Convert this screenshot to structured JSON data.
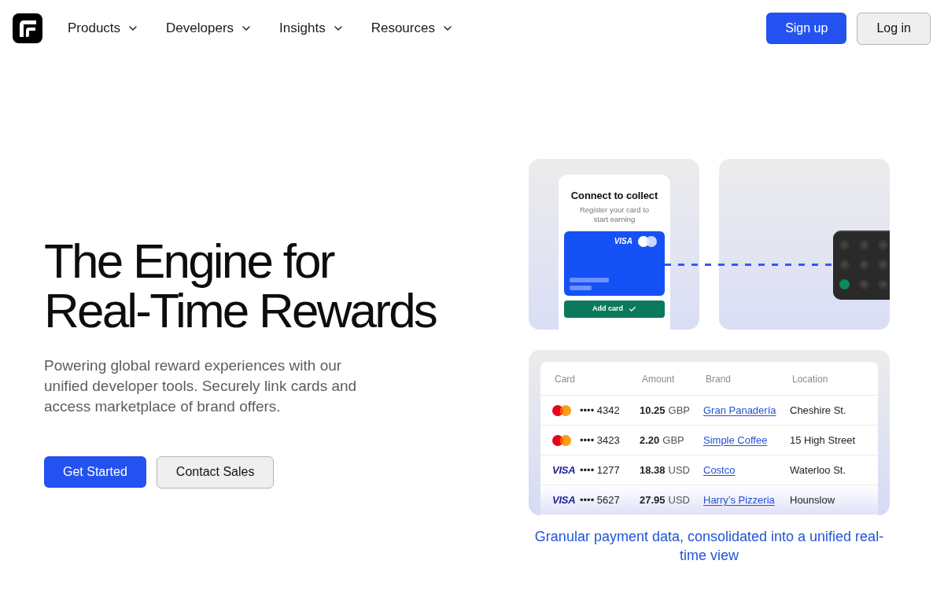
{
  "nav": {
    "items": [
      {
        "label": "Products"
      },
      {
        "label": "Developers"
      },
      {
        "label": "Insights"
      },
      {
        "label": "Resources"
      }
    ],
    "actions": [
      {
        "label": "Sign up",
        "kind": "primary"
      },
      {
        "label": "Log in",
        "kind": "secondary"
      }
    ]
  },
  "hero": {
    "title": "The Engine for Real-Time Rewards",
    "subtitle": "Powering global reward experiences with our unified developer tools. Securely link cards and access marketplace of brand offers.",
    "buttons": [
      {
        "label": "Get Started",
        "kind": "primary"
      },
      {
        "label": "Contact Sales",
        "kind": "secondary"
      }
    ]
  },
  "phone": {
    "title": "Connect to collect",
    "subtitle": "Register your card to start earning",
    "card_logo": "VISA",
    "button": "Add card"
  },
  "transactions": {
    "columns": [
      "Card",
      "Amount",
      "Brand",
      "Location"
    ],
    "rows": [
      {
        "network": {
          "kind": "mastercard"
        },
        "number": "•••• 4342",
        "amount": "10.25",
        "currency": "GBP",
        "brand": "Gran Panadería",
        "location": "Cheshire St."
      },
      {
        "network": {
          "kind": "mastercard"
        },
        "number": "•••• 3423",
        "amount": "2.20",
        "currency": "GBP",
        "brand": "Simple Coffee",
        "location": "15 High Street"
      },
      {
        "network": {
          "kind": "visa",
          "label": "VISA"
        },
        "number": "•••• 1277",
        "amount": "18.38",
        "currency": "USD",
        "brand": "Costco",
        "location": "Waterloo St."
      },
      {
        "network": {
          "kind": "visa",
          "label": "VISA"
        },
        "number": "•••• 5627",
        "amount": "27.95",
        "currency": "USD",
        "brand": "Harry’s Pizzeria",
        "location": "Hounslow"
      }
    ],
    "caption": "Granular payment data, consolidated into a unified real-time view"
  }
}
